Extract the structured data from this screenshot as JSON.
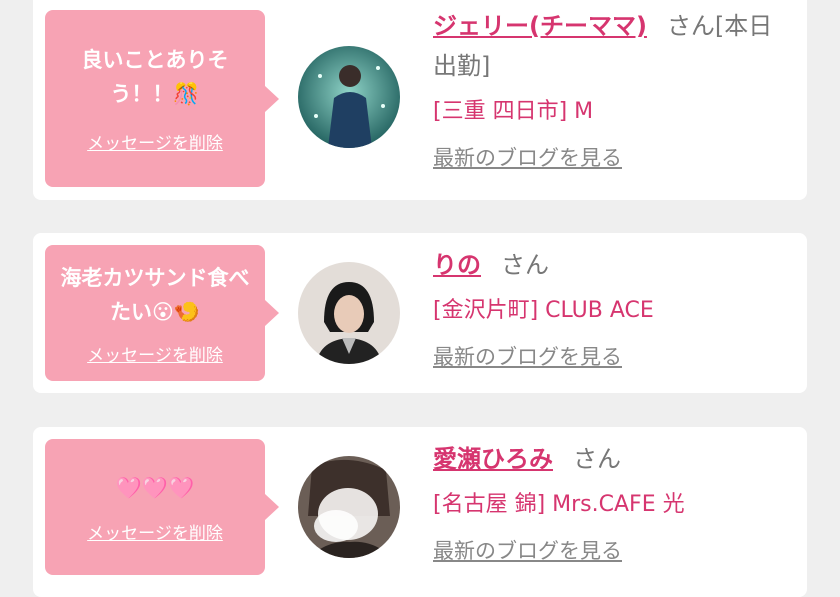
{
  "colors": {
    "accent": "#d6356f",
    "bubble": "#f7a3b4",
    "background": "#efefef"
  },
  "cards": [
    {
      "message": "良いことありそう！！",
      "message_emoji": "🎊",
      "delete_label": "メッセージを削除",
      "avatar_icon": "avatar-photo-icon",
      "name": "ジェリー(チーママ)",
      "suffix": "さん[本日出勤]",
      "shop": "[三重 四日市] M",
      "blog_label": "最新のブログを見る"
    },
    {
      "message": "海老カツサンド食べたい",
      "message_emoji": "😮🍤",
      "delete_label": "メッセージを削除",
      "avatar_icon": "avatar-photo-icon",
      "name": "りの",
      "suffix": "さん",
      "shop": "[金沢片町] CLUB ACE",
      "blog_label": "最新のブログを見る"
    },
    {
      "message": "",
      "message_emoji": "🩷🩷🩷",
      "delete_label": "メッセージを削除",
      "avatar_icon": "avatar-photo-icon",
      "name": "愛瀬ひろみ",
      "suffix": "さん",
      "shop": "[名古屋 錦] Mrs.CAFE 光",
      "blog_label": "最新のブログを見る"
    }
  ]
}
